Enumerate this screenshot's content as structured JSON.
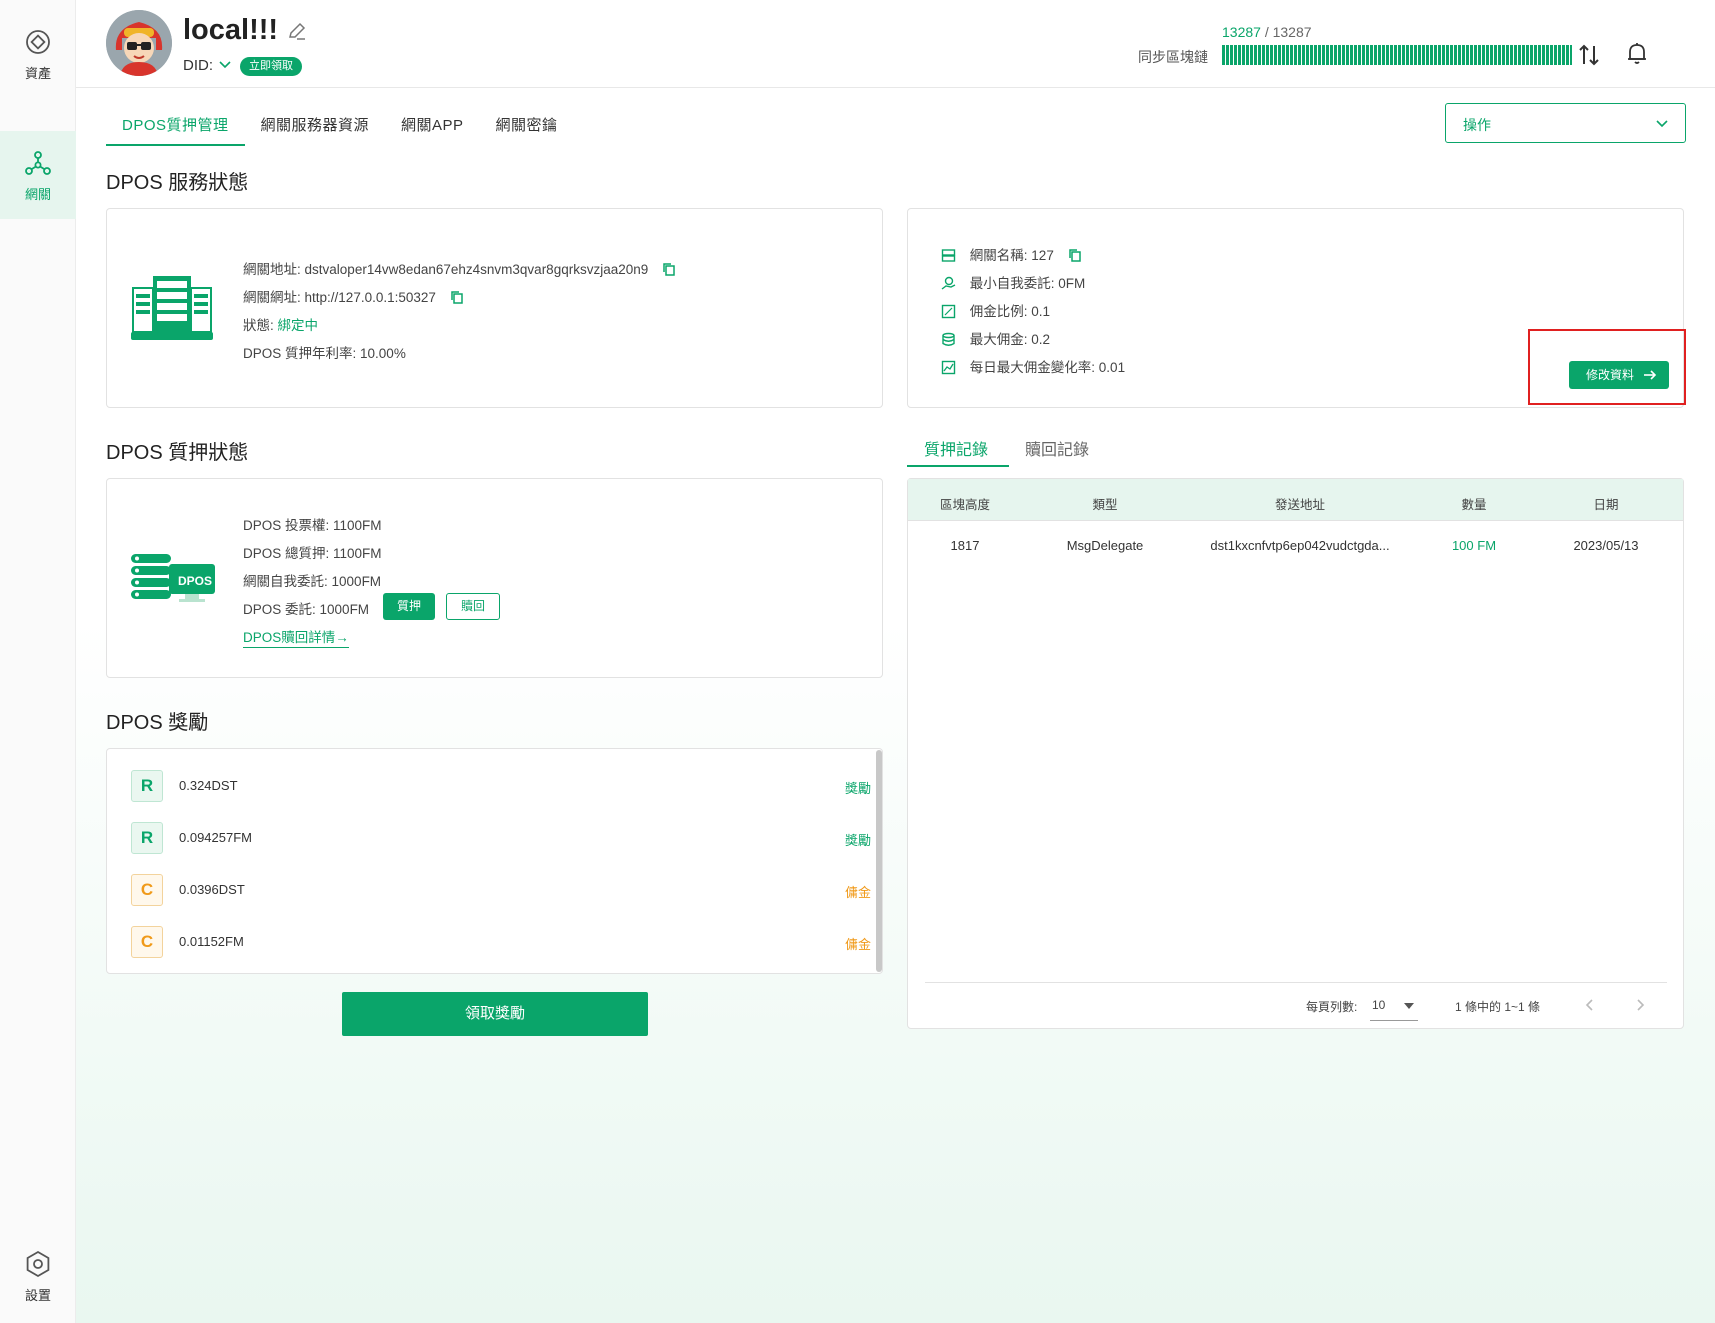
{
  "sidebar": {
    "items": [
      {
        "label": "資產",
        "icon": "asset-icon"
      },
      {
        "label": "網關",
        "icon": "gateway-icon"
      },
      {
        "label": "設置",
        "icon": "settings-icon"
      }
    ]
  },
  "header": {
    "node_name": "local!!!",
    "did_label": "DID:",
    "did_badge": "立即領取",
    "sync_current": "13287",
    "sync_total": "/ 13287",
    "sync_label": "同步區塊鏈",
    "sync_progress": 1.0
  },
  "tabs": [
    {
      "label": "DPOS質押管理",
      "active": true
    },
    {
      "label": "網關服務器資源"
    },
    {
      "label": "網關APP"
    },
    {
      "label": "網關密鑰"
    }
  ],
  "operation_select": {
    "label": "操作"
  },
  "service_status": {
    "title": "DPOS 服務狀態",
    "address_label": "網關地址:",
    "address_value": "dstvaloper14vw8edan67ehz4snvm3qvar8gqrksvzjaa20n9",
    "url_label": "網關網址:",
    "url_value": "http://127.0.0.1:50327",
    "state_label": "狀態:",
    "state_value": "綁定中",
    "apr_label": "DPOS 質押年利率:",
    "apr_value": "10.00%"
  },
  "gateway_info": {
    "name_label": "網關名稱:",
    "name_value": "127",
    "min_self_label": "最小自我委託:",
    "min_self_value": "0FM",
    "commission_label": "佣金比例:",
    "commission_value": "0.1",
    "max_commission_label": "最大佣金:",
    "max_commission_value": "0.2",
    "max_change_label": "每日最大佣金變化率:",
    "max_change_value": "0.01",
    "edit_button": "修改資料"
  },
  "stake_status": {
    "title": "DPOS 質押狀態",
    "vote_label": "DPOS 投票權:",
    "vote_value": "1100FM",
    "total_label": "DPOS 總質押:",
    "total_value": "1100FM",
    "self_label": "網關自我委託:",
    "self_value": "1000FM",
    "delegate_label": "DPOS 委託:",
    "delegate_value": "1000FM",
    "stake_button": "質押",
    "redeem_button": "贖回",
    "redeem_detail_link": "DPOS贖回詳情→",
    "icon_text": "DPOS"
  },
  "rewards": {
    "title": "DPOS 獎勵",
    "items": [
      {
        "badge": "R",
        "amount": "0.324DST",
        "kind": "獎勵"
      },
      {
        "badge": "R",
        "amount": "0.094257FM",
        "kind": "獎勵"
      },
      {
        "badge": "C",
        "amount": "0.0396DST",
        "kind": "傭金"
      },
      {
        "badge": "C",
        "amount": "0.01152FM",
        "kind": "傭金"
      }
    ],
    "claim_button": "領取獎勵"
  },
  "records": {
    "tabs": [
      {
        "label": "質押記錄",
        "active": true
      },
      {
        "label": "贖回記錄"
      }
    ],
    "columns": [
      "區塊高度",
      "類型",
      "發送地址",
      "數量",
      "日期"
    ],
    "rows": [
      [
        "1817",
        "MsgDelegate",
        "dst1kxcnfvtp6ep042vudctgda...",
        "100 FM",
        "2023/05/13"
      ]
    ],
    "pager": {
      "rows_label": "每頁列數:",
      "rows_value": "10",
      "range_text": "1 條中的 1~1 條"
    }
  },
  "colors": {
    "accent": "#0aa56a",
    "warning": "#f09a1a",
    "highlight": "#e02020"
  }
}
